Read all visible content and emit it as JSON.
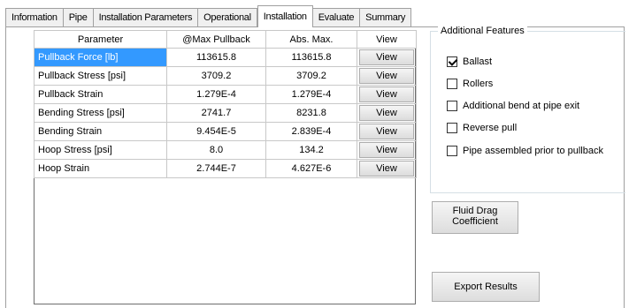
{
  "tabs": [
    {
      "label": "Information",
      "active": false
    },
    {
      "label": "Pipe",
      "active": false
    },
    {
      "label": "Installation Parameters",
      "active": false
    },
    {
      "label": "Operational",
      "active": false
    },
    {
      "label": "Installation",
      "active": true
    },
    {
      "label": "Evaluate",
      "active": false
    },
    {
      "label": "Summary",
      "active": false
    }
  ],
  "grid": {
    "columns": [
      "Parameter",
      "@Max Pullback",
      "Abs. Max.",
      "View"
    ],
    "rows": [
      {
        "parameter": "Pullback Force [lb]",
        "max_pullback": "113615.8",
        "abs_max": "113615.8",
        "view": "View",
        "selected": true
      },
      {
        "parameter": "Pullback Stress [psi]",
        "max_pullback": "3709.2",
        "abs_max": "3709.2",
        "view": "View"
      },
      {
        "parameter": "Pullback Strain",
        "max_pullback": "1.279E-4",
        "abs_max": "1.279E-4",
        "view": "View"
      },
      {
        "parameter": "Bending Stress [psi]",
        "max_pullback": "2741.7",
        "abs_max": "8231.8",
        "view": "View"
      },
      {
        "parameter": "Bending Strain",
        "max_pullback": "9.454E-5",
        "abs_max": "2.839E-4",
        "view": "View"
      },
      {
        "parameter": "Hoop Stress [psi]",
        "max_pullback": "8.0",
        "abs_max": "134.2",
        "view": "View"
      },
      {
        "parameter": "Hoop Strain",
        "max_pullback": "2.744E-7",
        "abs_max": "4.627E-6",
        "view": "View"
      }
    ]
  },
  "features": {
    "title": "Additional Features",
    "options": [
      {
        "label": "Ballast",
        "checked": true
      },
      {
        "label": "Rollers",
        "checked": false
      },
      {
        "label": "Additional bend at pipe exit",
        "checked": false
      },
      {
        "label": "Reverse pull",
        "checked": false
      },
      {
        "label": "Pipe assembled prior to pullback",
        "checked": false
      }
    ]
  },
  "buttons": {
    "fluid_drag_line1": "Fluid Drag",
    "fluid_drag_line2": "Coefficient",
    "export": "Export Results"
  },
  "colors": {
    "selection": "#3399ff",
    "border": "#a0a0a0"
  }
}
